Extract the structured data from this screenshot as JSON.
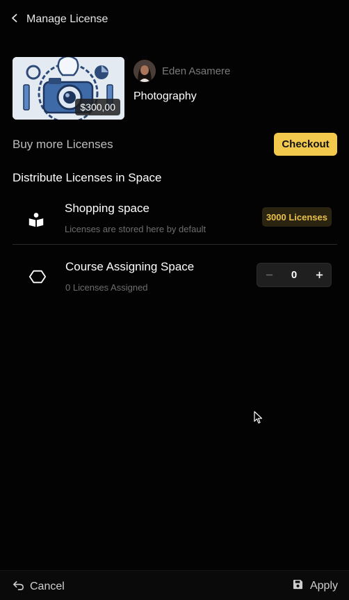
{
  "header": {
    "title": "Manage License"
  },
  "product": {
    "price": "$300,00",
    "owner_name": "Eden Asamere",
    "category": "Photography"
  },
  "buy": {
    "label": "Buy more Licenses",
    "checkout_label": "Checkout"
  },
  "distribute": {
    "title": "Distribute Licenses in Space",
    "spaces": [
      {
        "title": "Shopping space",
        "subtitle": "Licenses are stored here by default",
        "badge": "3000 Licenses",
        "icon": "book-reader-icon"
      },
      {
        "title": "Course Assigning Space",
        "subtitle": "0 Licenses Assigned",
        "stepper_value": "0",
        "icon": "hexagon-icon"
      }
    ]
  },
  "footer": {
    "cancel_label": "Cancel",
    "apply_label": "Apply"
  },
  "colors": {
    "accent": "#f2c94c",
    "background": "#030303",
    "badge_text": "#e8c14a"
  }
}
